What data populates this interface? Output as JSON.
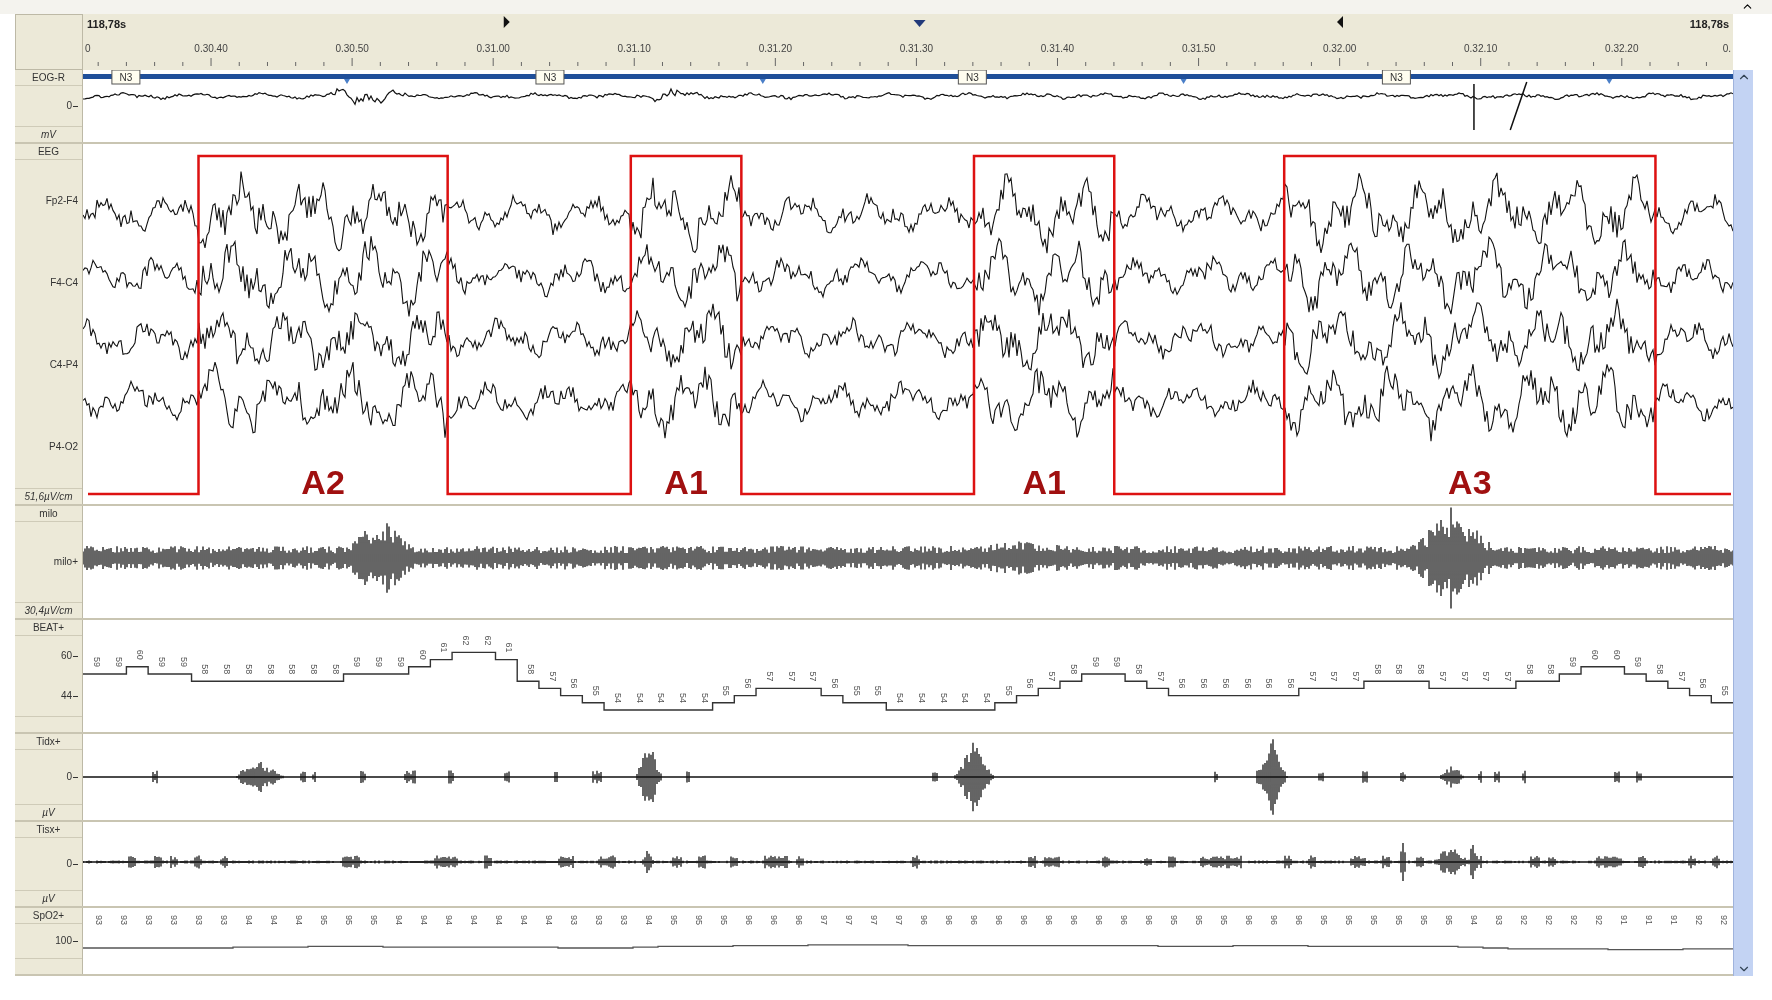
{
  "ruler": {
    "start": "118,78s",
    "end": "118,78s",
    "ticks": [
      "0",
      "0.30.40",
      "0.30.50",
      "0.31.00",
      "0.31.10",
      "0.31.20",
      "0.31.30",
      "0.31.40",
      "0.31.50",
      "0.32.00",
      "0.32.10",
      "0.32.20",
      "0."
    ]
  },
  "channels": [
    {
      "kind": "eog",
      "name": "EOG-R",
      "scale": [
        "0"
      ],
      "unit": "mV",
      "stage_tags": [
        "N3",
        "N3",
        "N3",
        "N3"
      ]
    },
    {
      "kind": "eeg",
      "name": "EEG",
      "leads": [
        "Fp2-F4",
        "F4-C4",
        "C4-P4",
        "P4-O2"
      ],
      "unit": "51,6µV/cm",
      "arousals": [
        "A2",
        "A1",
        "A1",
        "A3"
      ]
    },
    {
      "kind": "emg",
      "name": "milo",
      "lead": "milo+",
      "unit": "30,4µV/cm"
    },
    {
      "kind": "beat",
      "name": "BEAT+",
      "scale": [
        "60",
        "44"
      ],
      "values": [
        "59",
        "59",
        "60",
        "59",
        "59",
        "58",
        "58",
        "58",
        "58",
        "58",
        "58",
        "58",
        "59",
        "59",
        "59",
        "60",
        "61",
        "62",
        "62",
        "61",
        "58",
        "57",
        "56",
        "55",
        "54",
        "54",
        "54",
        "54",
        "54",
        "55",
        "56",
        "57",
        "57",
        "57",
        "56",
        "55",
        "55",
        "54",
        "54",
        "54",
        "54",
        "54",
        "55",
        "56",
        "57",
        "58",
        "59",
        "59",
        "58",
        "57",
        "56",
        "56",
        "56",
        "56",
        "56",
        "56",
        "57",
        "57",
        "57",
        "58",
        "58",
        "58",
        "57",
        "57",
        "57",
        "57",
        "58",
        "58",
        "59",
        "60",
        "60",
        "59",
        "58",
        "57",
        "56",
        "55"
      ]
    },
    {
      "kind": "burst",
      "name": "Tidx+",
      "scale": [
        "0"
      ],
      "unit": "µV"
    },
    {
      "kind": "spike",
      "name": "Tisx+",
      "scale": [
        "0"
      ],
      "unit": "µV"
    },
    {
      "kind": "spo2",
      "name": "SpO2+",
      "scale": [
        "100"
      ],
      "values": [
        "93",
        "93",
        "93",
        "93",
        "93",
        "93",
        "94",
        "94",
        "94",
        "95",
        "95",
        "95",
        "94",
        "94",
        "94",
        "94",
        "94",
        "94",
        "94",
        "93",
        "93",
        "93",
        "94",
        "95",
        "95",
        "95",
        "96",
        "96",
        "96",
        "97",
        "97",
        "97",
        "97",
        "96",
        "96",
        "96",
        "96",
        "96",
        "96",
        "96",
        "96",
        "96",
        "96",
        "95",
        "95",
        "95",
        "96",
        "96",
        "96",
        "95",
        "95",
        "95",
        "95",
        "95",
        "95",
        "94",
        "93",
        "92",
        "92",
        "92",
        "92",
        "91",
        "91",
        "91",
        "92",
        "92"
      ]
    }
  ]
}
